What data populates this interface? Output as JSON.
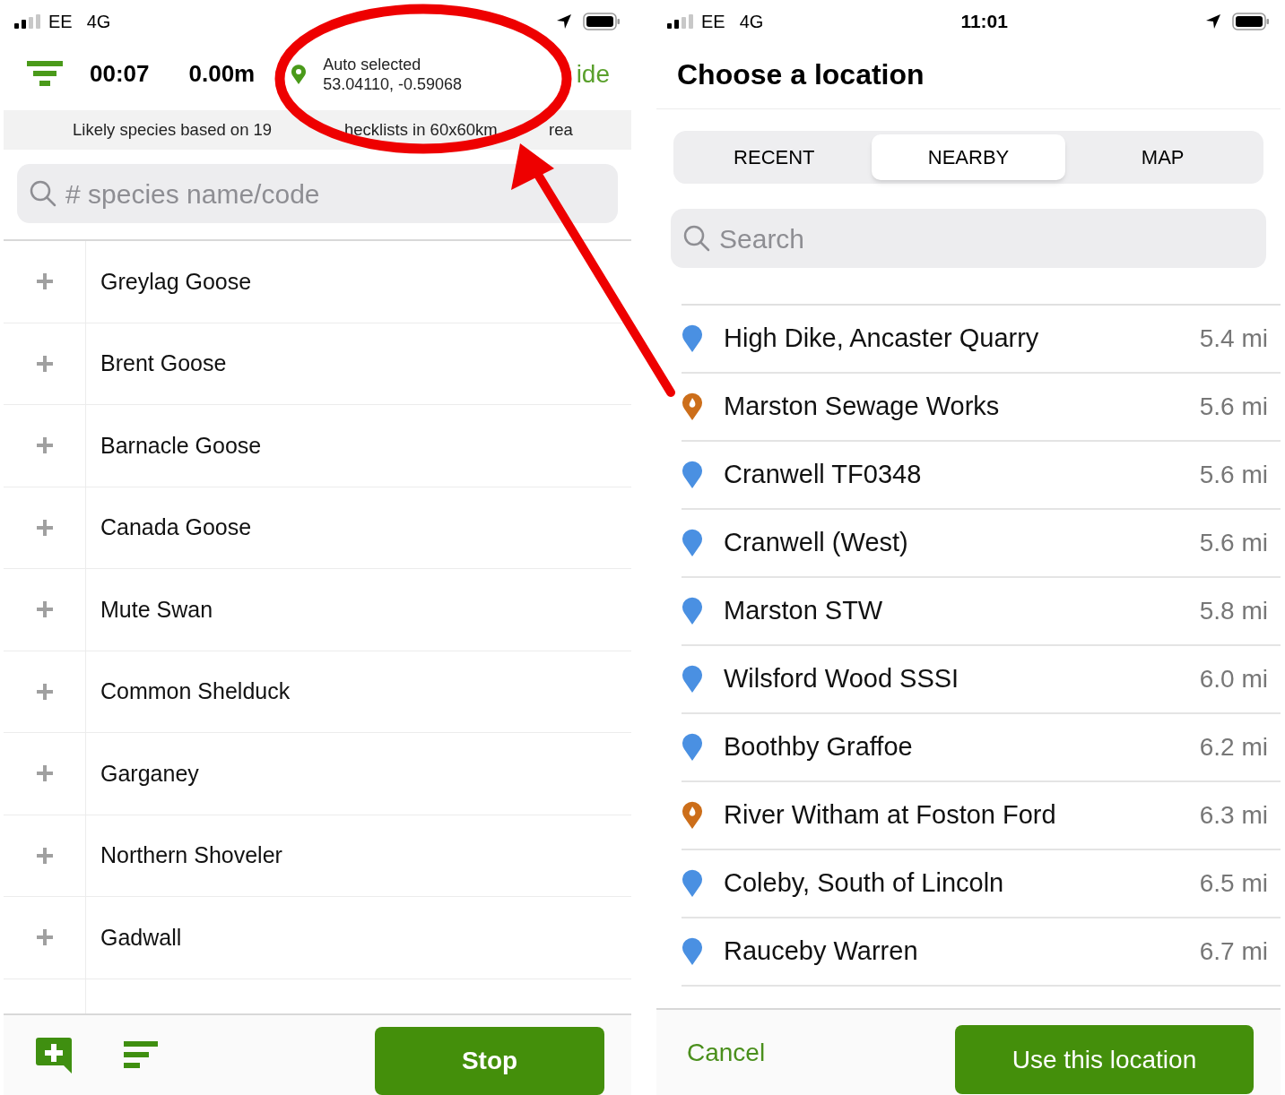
{
  "left": {
    "status_bar": {
      "carrier": "EE",
      "network": "4G"
    },
    "header": {
      "timer": "00:07",
      "distance": "0.00m",
      "location_label": "Auto selected",
      "coordinates": "53.04110, -0.59068",
      "hide": "ide"
    },
    "info": [
      "Likely species based on 19",
      "hecklists in 60x60km",
      "rea"
    ],
    "search": {
      "placeholder": "# species name/code"
    },
    "species": [
      {
        "name": "Greylag Goose"
      },
      {
        "name": "Brent Goose"
      },
      {
        "name": "Barnacle Goose"
      },
      {
        "name": "Canada Goose"
      },
      {
        "name": "Mute Swan"
      },
      {
        "name": "Common Shelduck"
      },
      {
        "name": "Garganey"
      },
      {
        "name": "Northern Shoveler"
      },
      {
        "name": "Gadwall"
      }
    ],
    "stop_button": "Stop"
  },
  "right": {
    "status_bar": {
      "carrier": "EE",
      "network": "4G",
      "time": "11:01"
    },
    "title": "Choose a location",
    "tabs": [
      {
        "label": "RECENT",
        "selected": false
      },
      {
        "label": "NEARBY",
        "selected": true
      },
      {
        "label": "MAP",
        "selected": false
      }
    ],
    "search": {
      "placeholder": "Search"
    },
    "locations": [
      {
        "name": "High Dike, Ancaster Quarry",
        "distance": "5.4 mi",
        "kind": "personal",
        "color": "#4a90e2"
      },
      {
        "name": "Marston Sewage Works",
        "distance": "5.6 mi",
        "kind": "hotspot",
        "color": "#cc6e1a"
      },
      {
        "name": "Cranwell TF0348",
        "distance": "5.6 mi",
        "kind": "personal",
        "color": "#4a90e2"
      },
      {
        "name": "Cranwell (West)",
        "distance": "5.6 mi",
        "kind": "personal",
        "color": "#4a90e2"
      },
      {
        "name": "Marston STW",
        "distance": "5.8 mi",
        "kind": "personal",
        "color": "#4a90e2"
      },
      {
        "name": "Wilsford Wood SSSI",
        "distance": "6.0 mi",
        "kind": "personal",
        "color": "#4a90e2"
      },
      {
        "name": "Boothby Graffoe",
        "distance": "6.2 mi",
        "kind": "personal",
        "color": "#4a90e2"
      },
      {
        "name": "River Witham at Foston Ford",
        "distance": "6.3 mi",
        "kind": "hotspot",
        "color": "#cc6e1a"
      },
      {
        "name": "Coleby, South of Lincoln",
        "distance": "6.5 mi",
        "kind": "personal",
        "color": "#4a90e2"
      },
      {
        "name": "Rauceby Warren",
        "distance": "6.7 mi",
        "kind": "personal",
        "color": "#4a90e2"
      }
    ],
    "cancel": "Cancel",
    "use_button": "Use this location"
  }
}
